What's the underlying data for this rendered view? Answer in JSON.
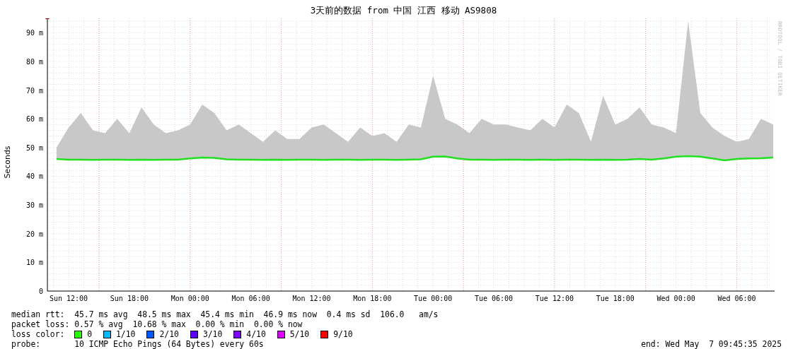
{
  "title": "3天前的数据 from 中国 江西 移动 AS9808",
  "credit": "RRDTOOL / TOBI OETIKER",
  "chart": {
    "chart_data": {
      "type": "line",
      "ylabel": "Seconds",
      "ylim": [
        0,
        95
      ],
      "grid": true,
      "categories": [
        null,
        "Sun 12:00",
        null,
        null,
        null,
        null,
        "Sun 18:00",
        null,
        null,
        null,
        null,
        "Mon 00:00",
        null,
        null,
        null,
        null,
        "Mon 06:00",
        null,
        null,
        null,
        null,
        "Mon 12:00",
        null,
        null,
        null,
        null,
        "Mon 18:00",
        null,
        null,
        null,
        null,
        "Tue 00:00",
        null,
        null,
        null,
        null,
        "Tue 06:00",
        null,
        null,
        null,
        null,
        "Tue 12:00",
        null,
        null,
        null,
        null,
        "Tue 18:00",
        null,
        null,
        null,
        null,
        "Wed 00:00",
        null,
        null,
        null,
        null,
        "Wed 06:00",
        null,
        null,
        null
      ],
      "yticks": [
        {
          "value": 0,
          "label": "0"
        },
        {
          "value": 10,
          "label": "10 m"
        },
        {
          "value": 20,
          "label": "20 m"
        },
        {
          "value": 30,
          "label": "30 m"
        },
        {
          "value": 40,
          "label": "40 m"
        },
        {
          "value": 50,
          "label": "50 m"
        },
        {
          "value": 60,
          "label": "60 m"
        },
        {
          "value": 70,
          "label": "70 m"
        },
        {
          "value": 80,
          "label": "80 m"
        },
        {
          "value": 90,
          "label": "90 m"
        }
      ],
      "series": [
        {
          "type": "area",
          "color": "#c8c8c8",
          "values": [
            50,
            57,
            62,
            56,
            55,
            60,
            55,
            64,
            58,
            55,
            56,
            58,
            65,
            62,
            56,
            58,
            55,
            52,
            56,
            53,
            53,
            57,
            58,
            55,
            52,
            57,
            54,
            55,
            52,
            58,
            57,
            75,
            60,
            58,
            55,
            60,
            58,
            58,
            57,
            56,
            60,
            57,
            65,
            62,
            52,
            68,
            58,
            60,
            64,
            58,
            57,
            55,
            94,
            62,
            57,
            54,
            52,
            53,
            60,
            58
          ]
        },
        {
          "type": "line",
          "color": "#20e020",
          "values": [
            46,
            45.8,
            45.8,
            45.7,
            45.8,
            45.8,
            45.7,
            45.8,
            45.7,
            45.8,
            45.8,
            46.2,
            46.5,
            46.4,
            45.9,
            45.8,
            45.8,
            45.7,
            45.8,
            45.7,
            45.8,
            45.8,
            45.7,
            45.8,
            45.8,
            45.7,
            45.8,
            45.8,
            45.7,
            45.8,
            45.9,
            46.8,
            46.9,
            46.2,
            45.8,
            45.8,
            45.7,
            45.8,
            45.8,
            45.7,
            45.8,
            45.7,
            45.8,
            45.8,
            45.7,
            45.8,
            45.7,
            45.8,
            46,
            45.8,
            46.2,
            46.8,
            47,
            46.8,
            46.2,
            45.5,
            46,
            46.2,
            46.3,
            46.5
          ]
        }
      ]
    }
  },
  "legend": [
    {
      "kind": "text",
      "label": "median rtt:",
      "value": "45.7 ms avg  48.5 ms max  45.4 ms min  46.9 ms now  0.4 ms sd  106.0   am/s"
    },
    {
      "kind": "text",
      "label": "packet loss:",
      "value": "0.57 % avg  10.68 % max  0.00 % min  0.00 % now"
    },
    {
      "kind": "swatches",
      "label": "loss color:",
      "items": [
        {
          "label": "0",
          "color": "#26ff00"
        },
        {
          "label": "1/10",
          "color": "#00b8ff"
        },
        {
          "label": "2/10",
          "color": "#0059ff"
        },
        {
          "label": "3/10",
          "color": "#5e00ff"
        },
        {
          "label": "4/10",
          "color": "#7e00ff"
        },
        {
          "label": "5/10",
          "color": "#dd00ff"
        },
        {
          "label": "9/10",
          "color": "#ff0000"
        }
      ]
    },
    {
      "kind": "text",
      "label": "probe:",
      "value": "10 ICMP Echo Pings (64 Bytes) every 60s",
      "end": "end: Wed May  7 09:45:35 2025"
    }
  ]
}
